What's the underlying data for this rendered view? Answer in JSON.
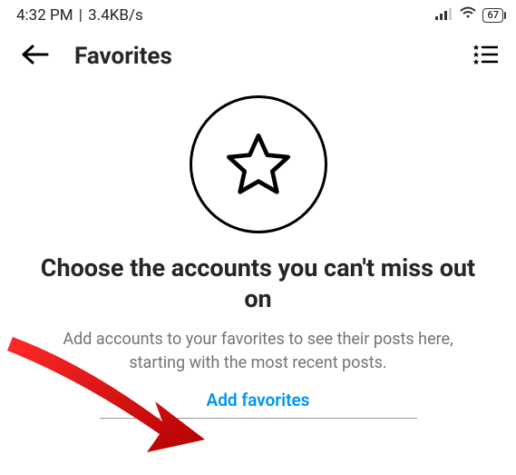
{
  "status_bar": {
    "time": "4:32 PM",
    "separator": "|",
    "net_speed": "3.4KB/s",
    "battery_percent": "67"
  },
  "header": {
    "title": "Favorites"
  },
  "empty_state": {
    "heading": "Choose the accounts you can't miss out on",
    "subtext": "Add accounts to your favorites to see their posts here, starting with the most recent posts.",
    "link_label": "Add favorites"
  },
  "icons": {
    "back": "back-arrow-icon",
    "list": "list-star-icon",
    "signal": "signal-icon",
    "wifi": "wifi-icon",
    "star": "star-outline-icon"
  },
  "colors": {
    "accent": "#0095f6",
    "muted": "#737373",
    "annotation": "#e60000"
  }
}
